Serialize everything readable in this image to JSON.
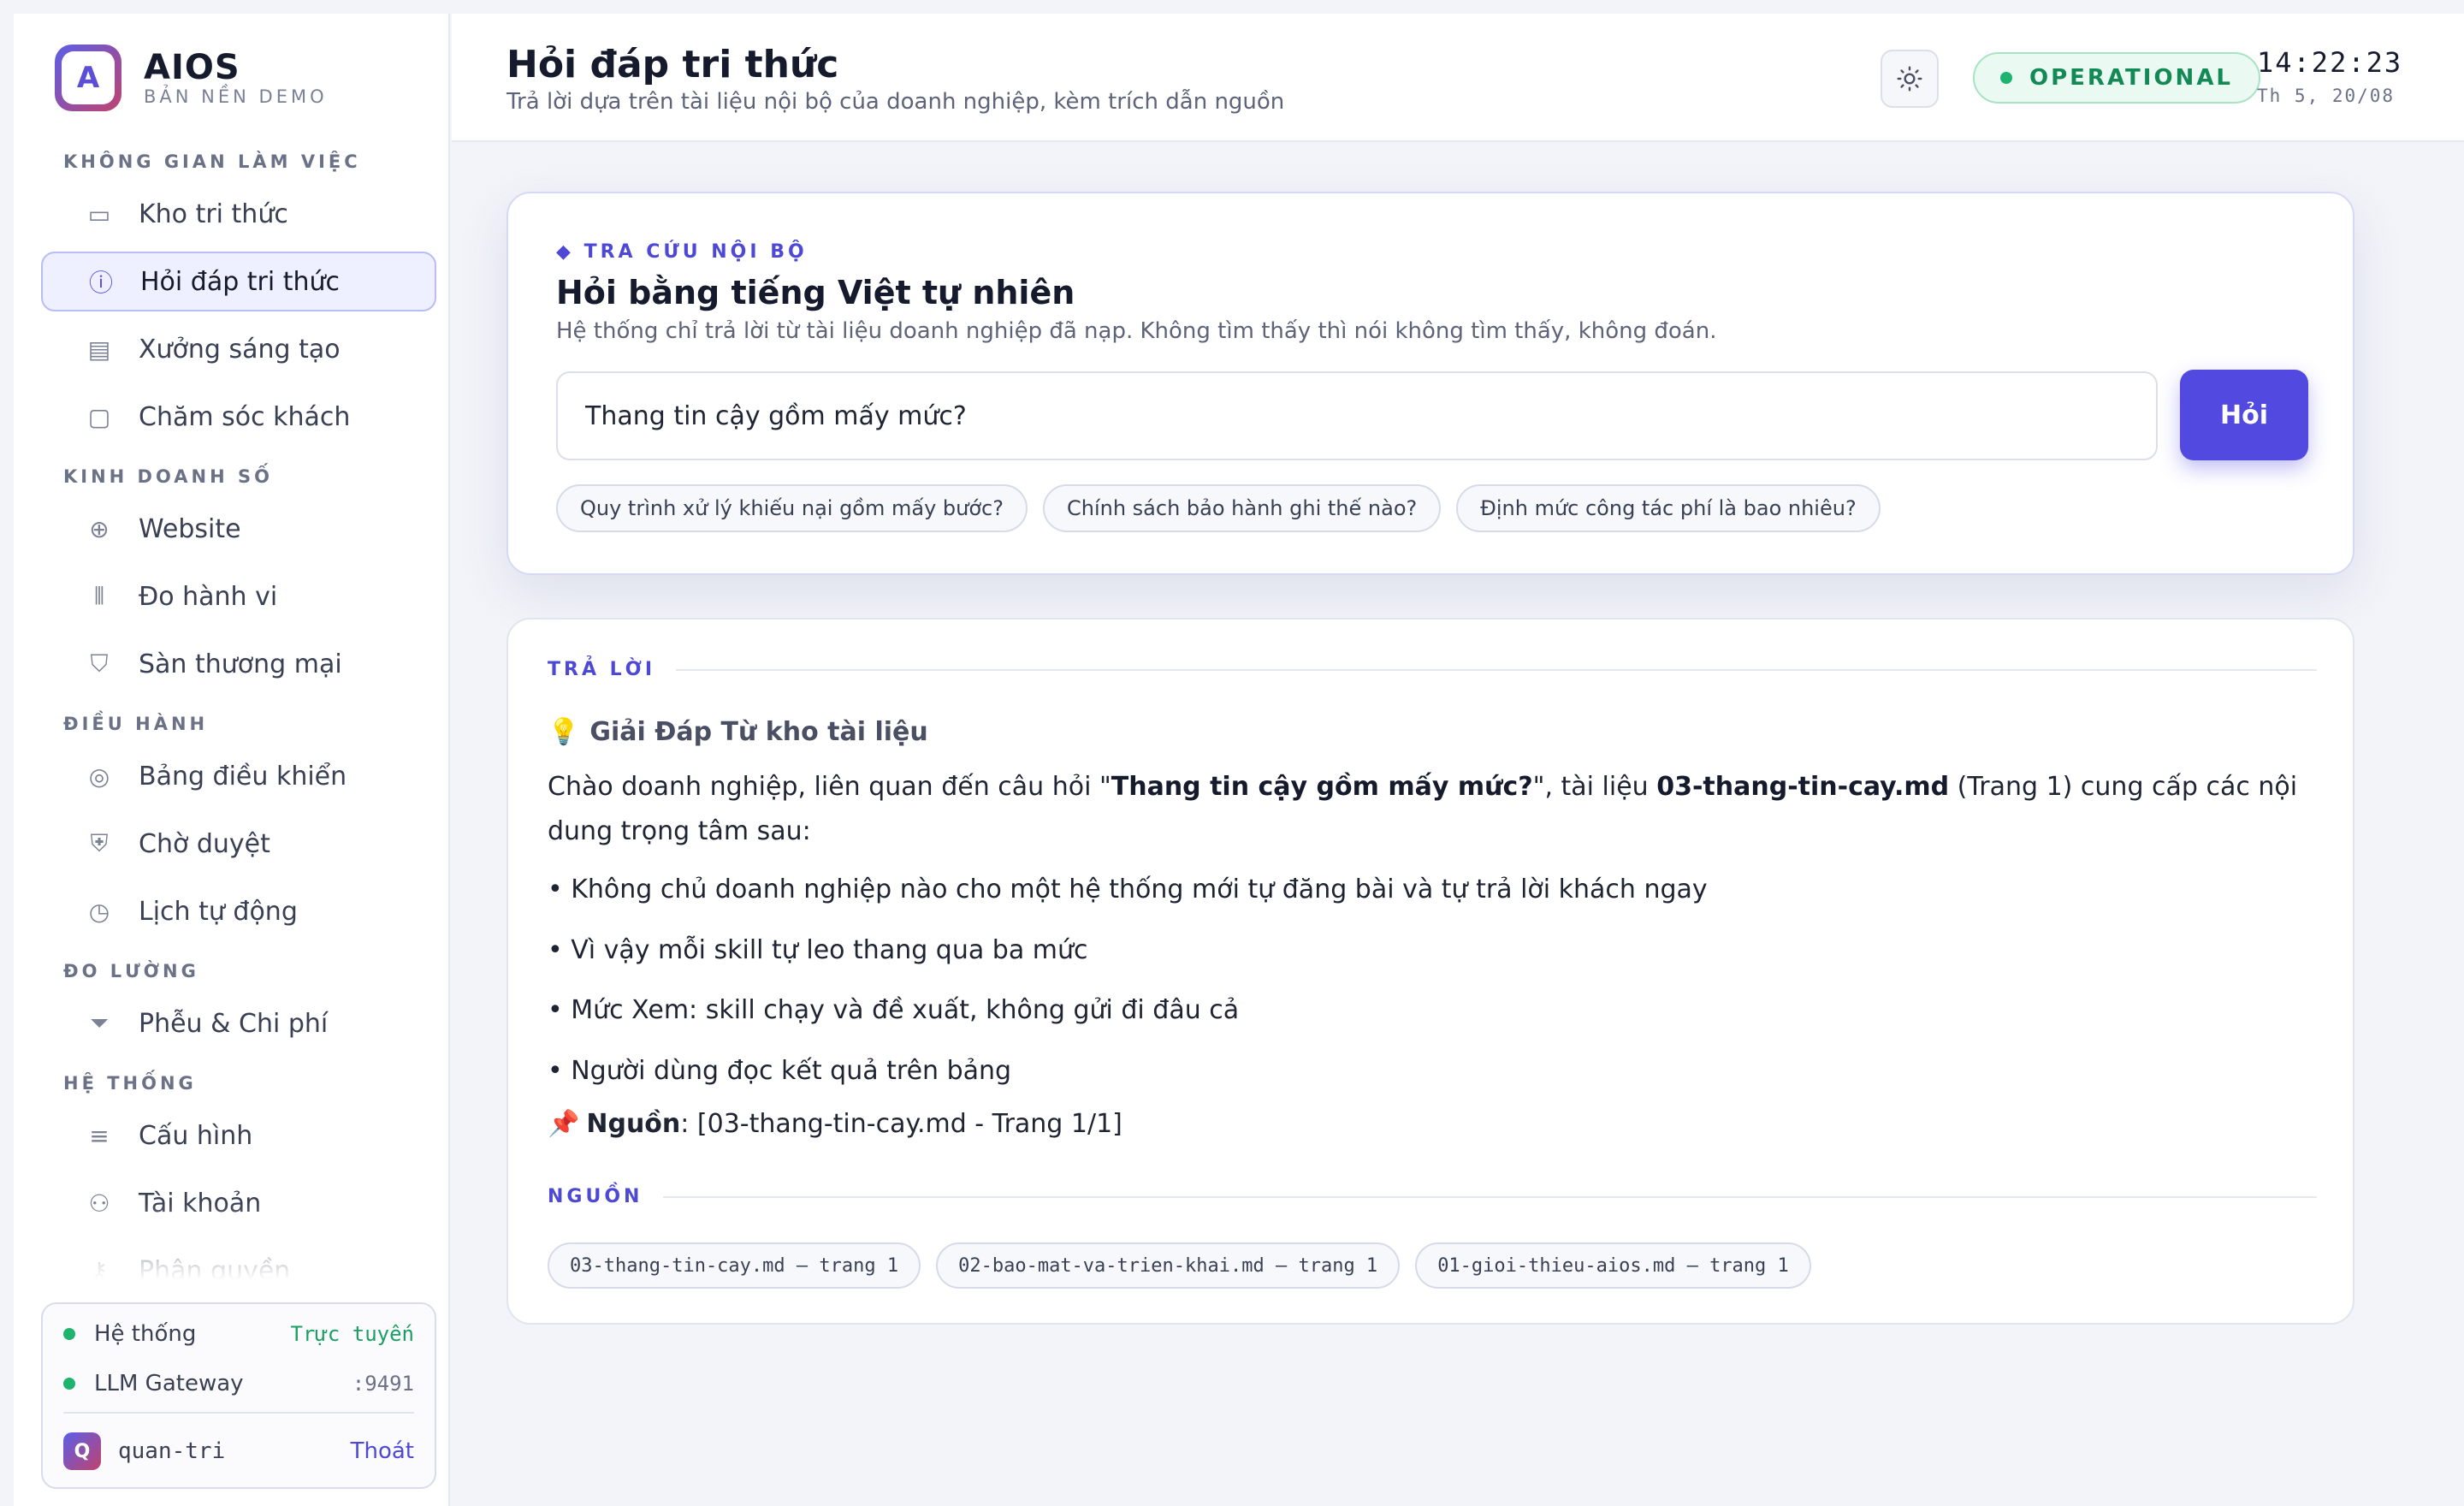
{
  "brand": {
    "logo_letter": "A",
    "name": "AIOS",
    "subtitle": "BẢN NỀN DEMO"
  },
  "sidebar": {
    "sections": [
      {
        "title": "KHÔNG GIAN LÀM VIỆC",
        "items": [
          {
            "label": "Kho tri thức",
            "icon": "book-icon",
            "active": false
          },
          {
            "label": "Hỏi đáp tri thức",
            "icon": "question-icon",
            "active": true
          },
          {
            "label": "Xưởng sáng tạo",
            "icon": "media-icon",
            "active": false
          },
          {
            "label": "Chăm sóc khách",
            "icon": "chat-icon",
            "active": false
          }
        ]
      },
      {
        "title": "KINH DOANH SỐ",
        "items": [
          {
            "label": "Website",
            "icon": "globe-icon",
            "active": false
          },
          {
            "label": "Đo hành vi",
            "icon": "bar-chart-icon",
            "active": false
          },
          {
            "label": "Sàn thương mại",
            "icon": "shopping-bag-icon",
            "active": false
          }
        ]
      },
      {
        "title": "ĐIỀU HÀNH",
        "items": [
          {
            "label": "Bảng điều khiển",
            "icon": "gauge-icon",
            "active": false
          },
          {
            "label": "Chờ duyệt",
            "icon": "shield-icon",
            "active": false
          },
          {
            "label": "Lịch tự động",
            "icon": "clock-icon",
            "active": false
          }
        ]
      },
      {
        "title": "ĐO LƯỜNG",
        "items": [
          {
            "label": "Phễu & Chi phí",
            "icon": "funnel-icon",
            "active": false
          }
        ]
      },
      {
        "title": "HỆ THỐNG",
        "items": [
          {
            "label": "Cấu hình",
            "icon": "sliders-icon",
            "active": false
          },
          {
            "label": "Tài khoản",
            "icon": "users-icon",
            "active": false
          },
          {
            "label": "Phân quyền",
            "icon": "key-icon",
            "active": false
          }
        ]
      }
    ]
  },
  "status": {
    "system_label": "Hệ thống",
    "system_value": "Trực tuyến",
    "gateway_label": "LLM Gateway",
    "gateway_value": ":9491",
    "user_initial": "Q",
    "user_name": "quan-tri",
    "logout_label": "Thoát"
  },
  "header": {
    "title": "Hỏi đáp tri thức",
    "subtitle": "Trả lời dựa trên tài liệu nội bộ của doanh nghiệp, kèm trích dẫn nguồn",
    "theme_icon": "sun-icon",
    "status_badge": "OPERATIONAL",
    "time": "14:22:23",
    "date": "Th 5, 20/08"
  },
  "query": {
    "kicker": "◆ TRA CỨU NỘI BỘ",
    "title": "Hỏi bằng tiếng Việt tự nhiên",
    "description": "Hệ thống chỉ trả lời từ tài liệu doanh nghiệp đã nạp. Không tìm thấy thì nói không tìm thấy, không đoán.",
    "input_value": "Thang tin cậy gồm mấy mức?",
    "ask_button": "Hỏi",
    "suggestions": [
      "Quy trình xử lý khiếu nại gồm mấy bước?",
      "Chính sách bảo hành ghi thế nào?",
      "Định mức công tác phí là bao nhiêu?"
    ]
  },
  "answer": {
    "section_label": "TRẢ LỜI",
    "heading_icon": "💡",
    "heading": "Giải Đáp Từ kho tài liệu",
    "intro_prefix": "Chào doanh nghiệp, liên quan đến câu hỏi \"",
    "intro_question": "Thang tin cậy gồm mấy mức?",
    "intro_mid": "\", tài liệu ",
    "intro_doc": "03-thang-tin-cay.md",
    "intro_suffix": " (Trang 1) cung cấp các nội dung trọng tâm sau:",
    "bullets": [
      "• Không chủ doanh nghiệp nào cho một hệ thống mới tự đăng bài và tự trả lời khách ngay",
      "• Vì vậy mỗi skill tự leo thang qua ba mức",
      "• Mức Xem: skill chạy và đề xuất, không gửi đi đâu cả",
      "• Người dùng đọc kết quả trên bảng"
    ],
    "source_icon": "📌",
    "source_label": "Nguồn",
    "source_text": ": [03-thang-tin-cay.md - Trang 1/1]",
    "sources_section_label": "NGUỒN",
    "sources": [
      "03-thang-tin-cay.md — trang 1",
      "02-bao-mat-va-trien-khai.md — trang 1",
      "01-gioi-thieu-aios.md — trang 1"
    ]
  }
}
